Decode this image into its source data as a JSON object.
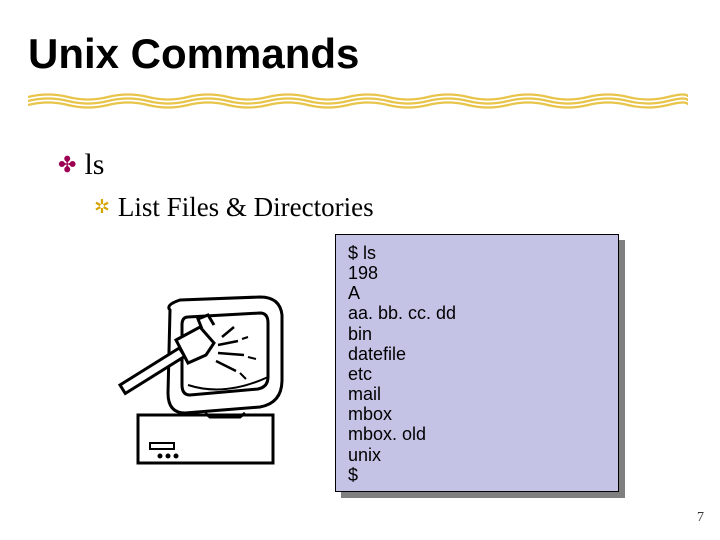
{
  "title": "Unix Commands",
  "bullets": {
    "level1": {
      "marker": "✤",
      "text": "ls"
    },
    "level2": {
      "marker": "✲",
      "text": "List Files & Directories"
    }
  },
  "terminal": {
    "lines": [
      "$ ls",
      "198",
      "A",
      "aa. bb. cc. dd",
      "bin",
      "datefile",
      "etc",
      "mail",
      "mbox",
      "mbox. old",
      "unix",
      "$"
    ]
  },
  "page_number": "7",
  "icons": {
    "computer_alt": "computer clipart"
  }
}
